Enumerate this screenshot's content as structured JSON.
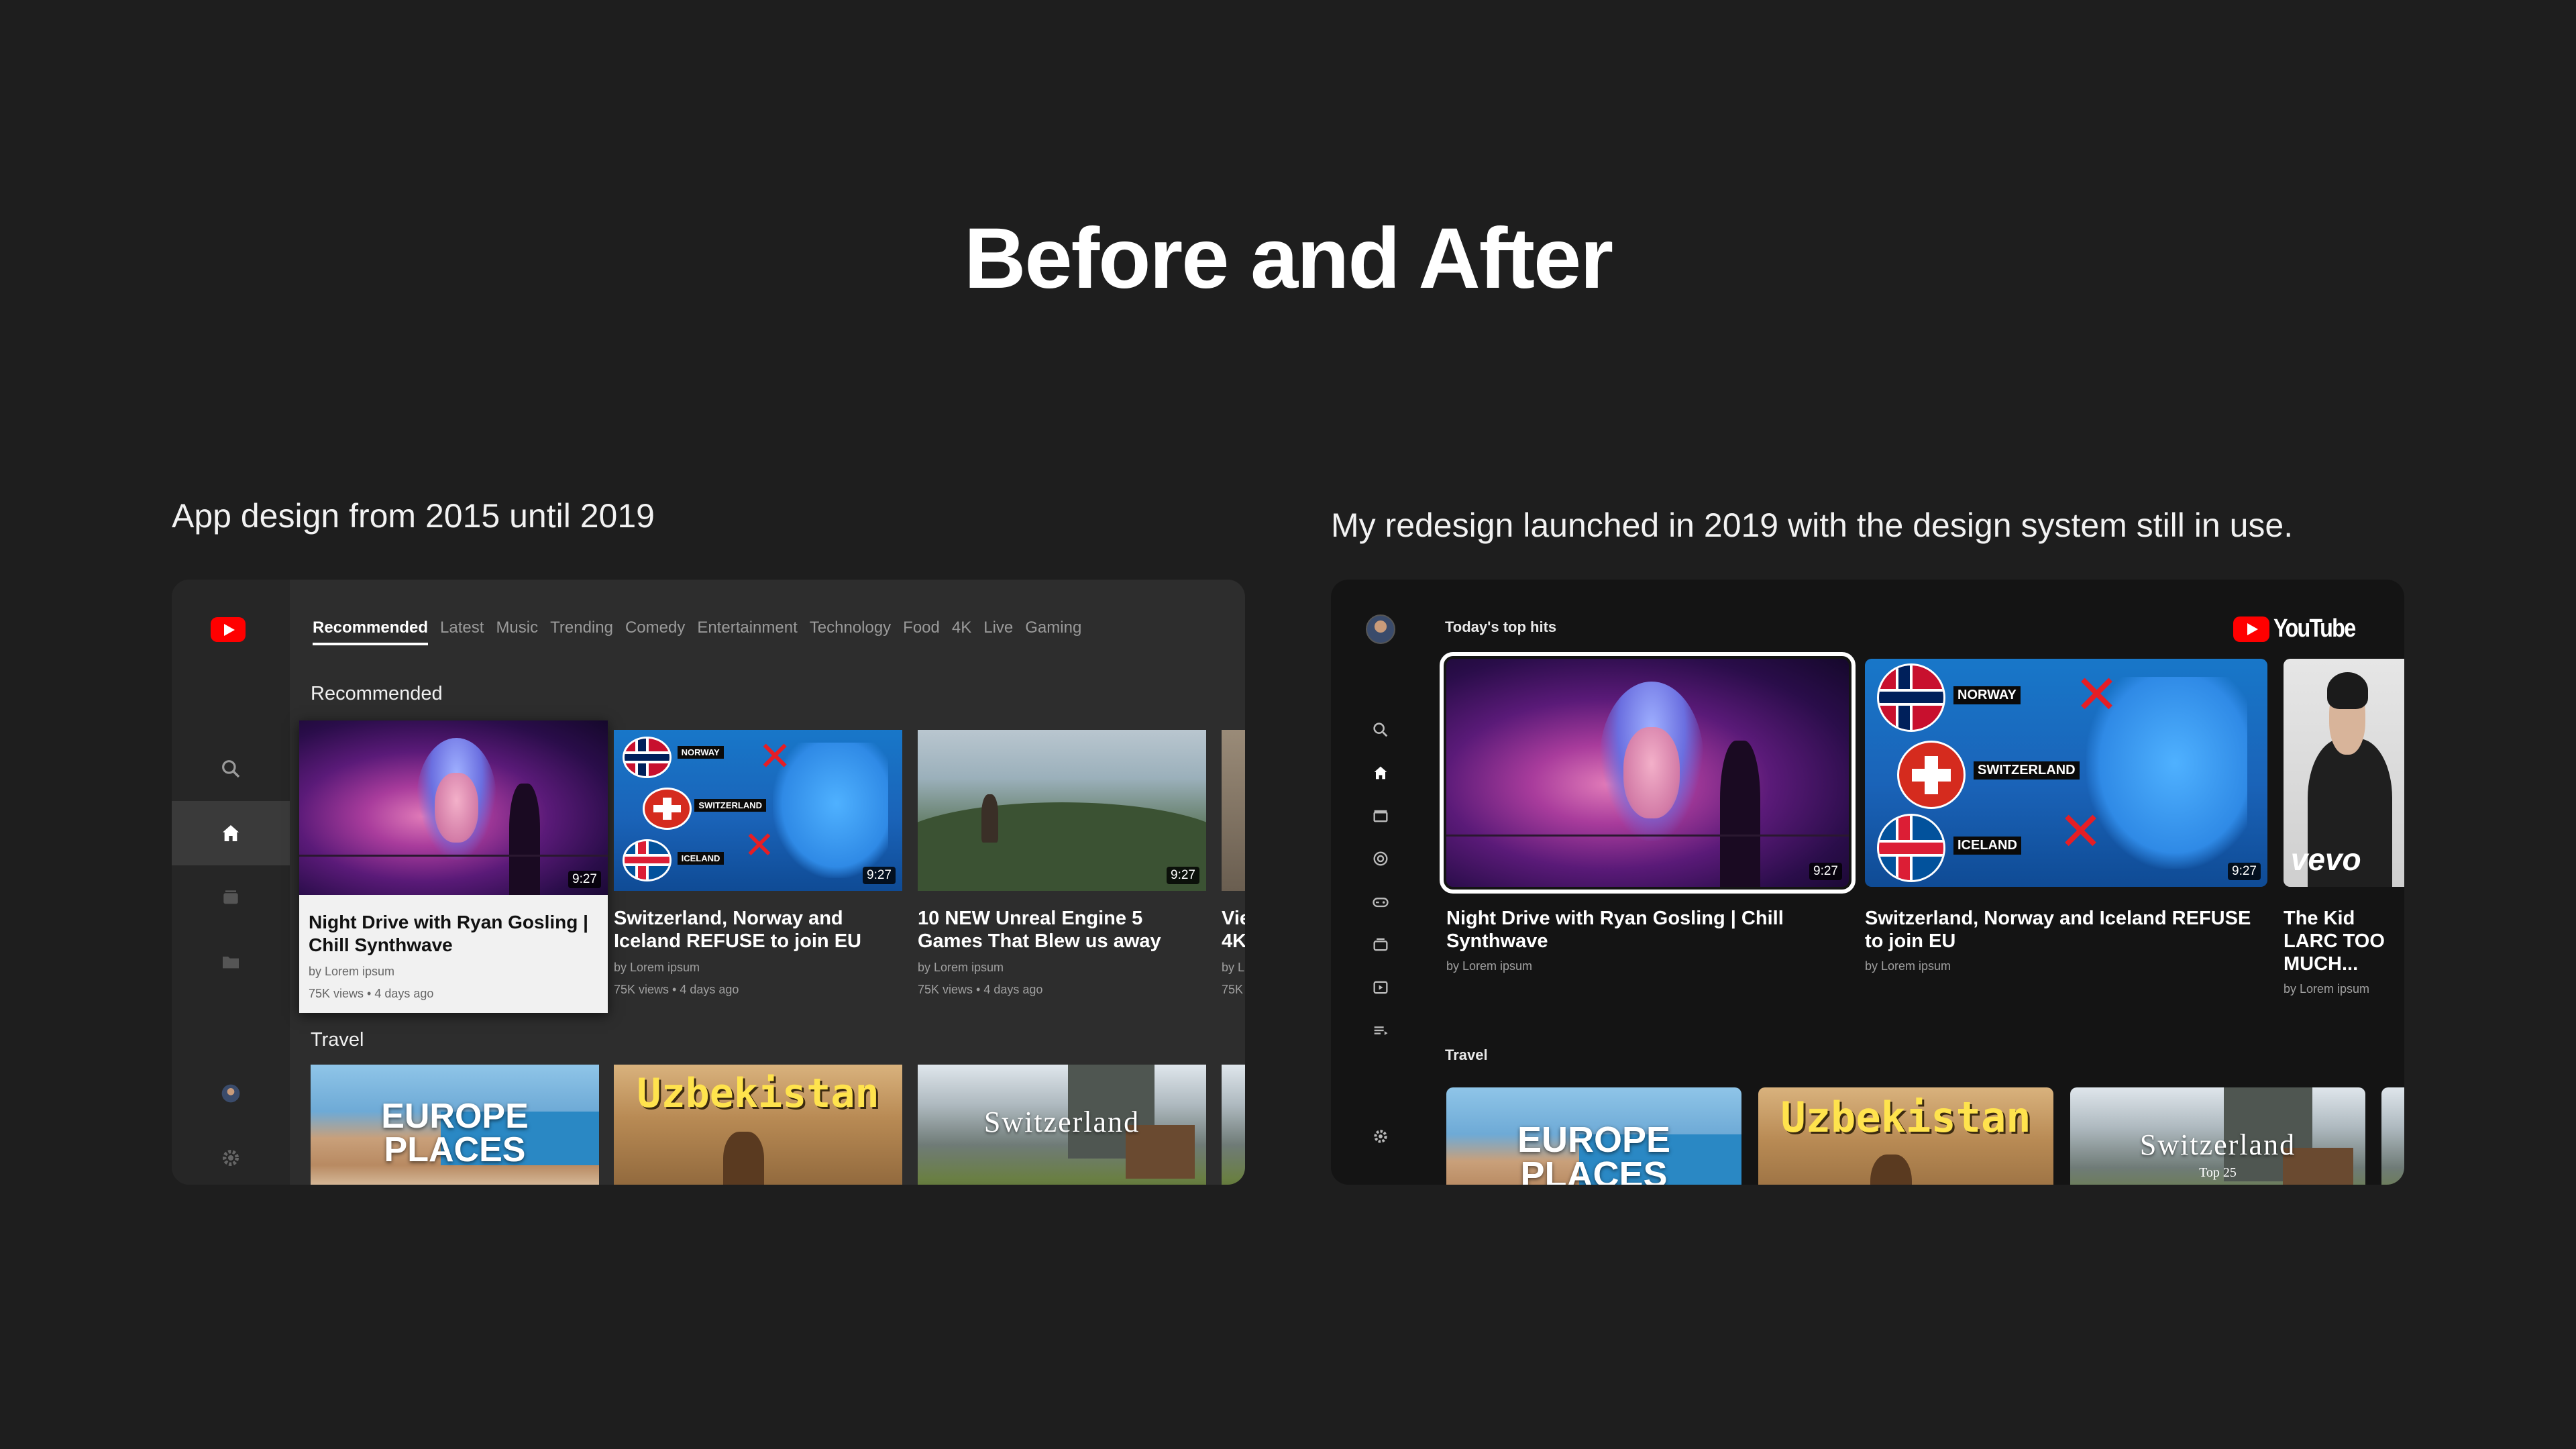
{
  "page": {
    "title": "Before and After",
    "caption_before": "App design from 2015 until 2019",
    "caption_after": "My redesign launched in 2019 with the design system still in use."
  },
  "before": {
    "tabs": [
      "Recommended",
      "Latest",
      "Music",
      "Trending",
      "Comedy",
      "Entertainment",
      "Technology",
      "Food",
      "4K",
      "Live",
      "Gaming"
    ],
    "active_tab": "Recommended",
    "section_recommended": "Recommended",
    "section_travel": "Travel",
    "sidebar_icons": [
      "search-icon",
      "home-icon",
      "subscriptions-icon",
      "library-icon",
      "account-avatar",
      "settings-icon"
    ],
    "cards": [
      {
        "title": "Night Drive with Ryan Gosling | Chill Synthwave",
        "channel": "by Lorem ipsum",
        "stats": "75K views • 4 days ago",
        "duration": "9:27",
        "focused": true
      },
      {
        "title": "Switzerland, Norway and Iceland REFUSE to join EU",
        "channel": "by Lorem ipsum",
        "stats": "75K views • 4 days ago",
        "duration": "9:27"
      },
      {
        "title": "10 NEW Unreal Engine 5 Games That Blew us away",
        "channel": "by Lorem ipsum",
        "stats": "75K views • 4 days ago",
        "duration": "9:27"
      },
      {
        "title": "Vie 4K",
        "channel": "by L",
        "stats": "75K",
        "duration": ""
      }
    ],
    "map_labels": {
      "norway": "NORWAY",
      "switzerland": "SWITZERLAND",
      "iceland": "ICELAND"
    },
    "travel": [
      {
        "overlay": "EUROPE PLACES"
      },
      {
        "overlay": "Uzbekistan"
      },
      {
        "overlay": "Switzerland",
        "sub": ""
      }
    ]
  },
  "after": {
    "heading": "Today's top hits",
    "section_travel": "Travel",
    "brand": "YouTube",
    "sidebar_icons": [
      "search-icon",
      "home-icon",
      "clapperboard-icon",
      "target-icon",
      "gamepad-icon",
      "subscriptions-icon",
      "playlist-play-icon",
      "queue-icon",
      "settings-icon"
    ],
    "cards": [
      {
        "title": "Night Drive with Ryan Gosling | Chill Synthwave",
        "channel": "by Lorem ipsum",
        "duration": "9:27",
        "focused": true
      },
      {
        "title": "Switzerland, Norway and Iceland REFUSE to join EU",
        "channel": "by Lorem ipsum",
        "duration": "9:27"
      },
      {
        "title": "The Kid LARC TOO MUCH...",
        "channel": "by Lorem ipsum",
        "duration": "",
        "badge": "vevo"
      }
    ],
    "map_labels": {
      "norway": "NORWAY",
      "switzerland": "SWITZERLAND",
      "iceland": "ICELAND"
    },
    "travel": [
      {
        "overlay": "EUROPE PLACES"
      },
      {
        "overlay": "Uzbekistan"
      },
      {
        "overlay": "Switzerland",
        "sub": "Top 25"
      }
    ]
  },
  "colors": {
    "background": "#1e1e1e",
    "before_panel": "#2d2d2d",
    "after_panel": "#141414",
    "brand_red": "#ff0000"
  }
}
